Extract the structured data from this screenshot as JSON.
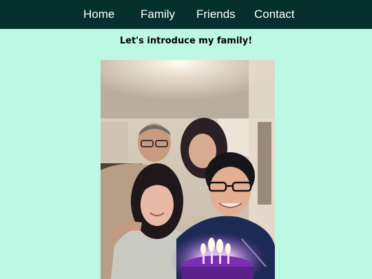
{
  "nav": {
    "items": [
      {
        "label": "Home"
      },
      {
        "label": "Family"
      },
      {
        "label": "Friends"
      },
      {
        "label": "Contact"
      }
    ]
  },
  "main": {
    "heading": "Let's introduce my family!"
  },
  "colors": {
    "navbar_bg": "#05302e",
    "page_bg": "#bdf8e4",
    "nav_text": "#ffffff"
  }
}
